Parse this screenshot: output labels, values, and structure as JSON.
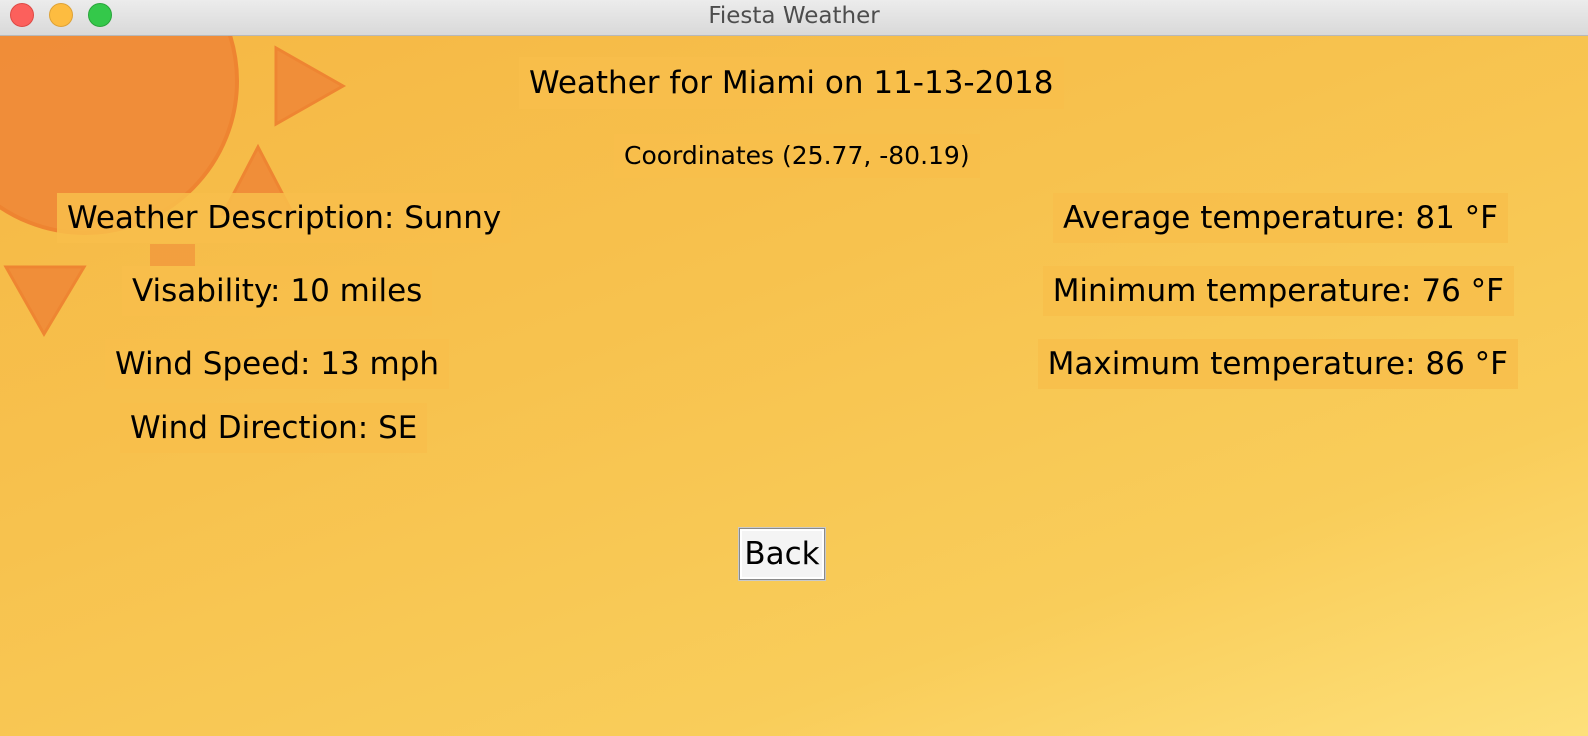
{
  "window": {
    "title": "Fiesta Weather"
  },
  "header": {
    "title": "Weather for Miami on 11-13-2018",
    "coordinates": "Coordinates (25.77, -80.19)"
  },
  "left_details": {
    "description": "Weather Description: Sunny",
    "visibility": "Visability: 10 miles",
    "wind_speed": "Wind Speed: 13 mph",
    "wind_direction": "Wind Direction: SE"
  },
  "right_details": {
    "avg_temp": "Average temperature: 81 °F",
    "min_temp": "Minimum temperature: 76 °F",
    "max_temp": "Maximum temperature: 86 °F"
  },
  "actions": {
    "back_label": "Back"
  },
  "colors": {
    "background": "#f7c24e",
    "sun": "#f08a38",
    "label_bg": "#f8be4b"
  }
}
